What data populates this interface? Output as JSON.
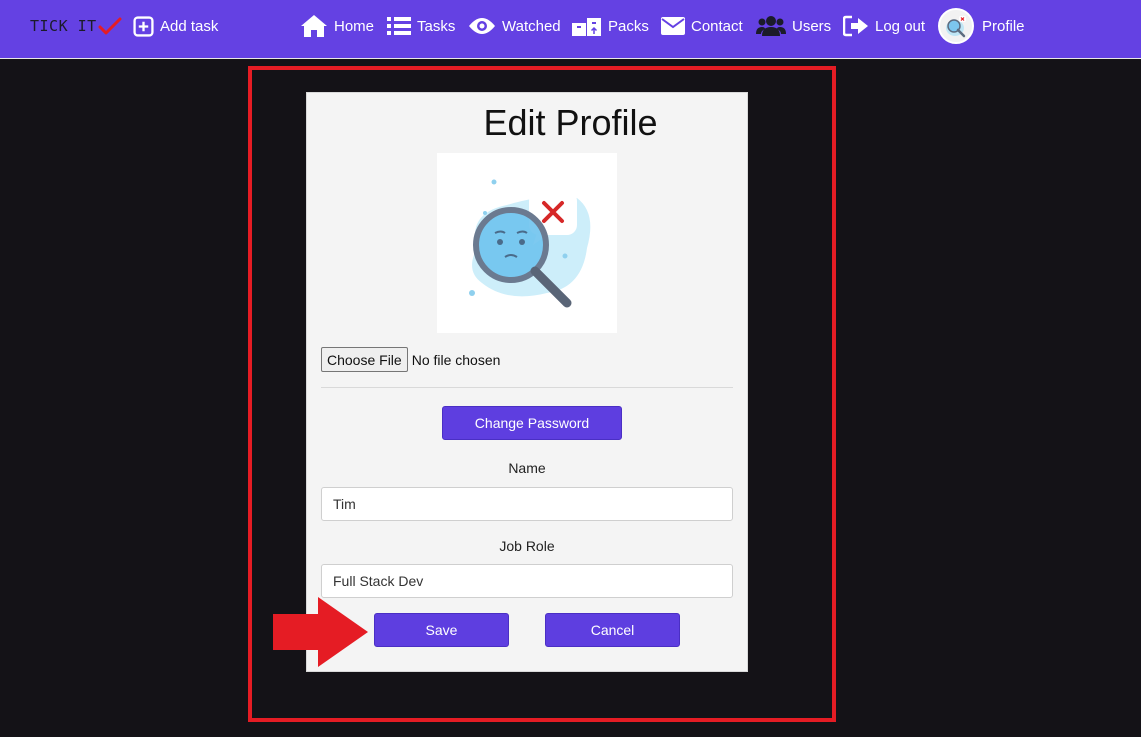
{
  "navbar": {
    "logo_text": "TICK IT",
    "items": [
      {
        "label": "Add task",
        "icon": "plus-square-icon"
      },
      {
        "label": "Home",
        "icon": "home-icon"
      },
      {
        "label": "Tasks",
        "icon": "list-icon"
      },
      {
        "label": "Watched",
        "icon": "eye-icon"
      },
      {
        "label": "Packs",
        "icon": "boxes-icon"
      },
      {
        "label": "Contact",
        "icon": "envelope-icon"
      },
      {
        "label": "Users",
        "icon": "users-icon"
      },
      {
        "label": "Log out",
        "icon": "sign-out-icon"
      },
      {
        "label": "Profile",
        "icon": "avatar"
      }
    ]
  },
  "form": {
    "title": "Edit Profile",
    "file_button_label": "Choose File",
    "file_status": "No file chosen",
    "change_password_label": "Change Password",
    "name_label": "Name",
    "name_value": "Tim",
    "job_role_label": "Job Role",
    "job_role_value": "Full Stack Dev",
    "save_label": "Save",
    "cancel_label": "Cancel"
  },
  "colors": {
    "navbar": "#6441e3",
    "button": "#5e3ee0",
    "highlight": "#e51c24",
    "background": "#141217",
    "card": "#f4f4f4"
  }
}
